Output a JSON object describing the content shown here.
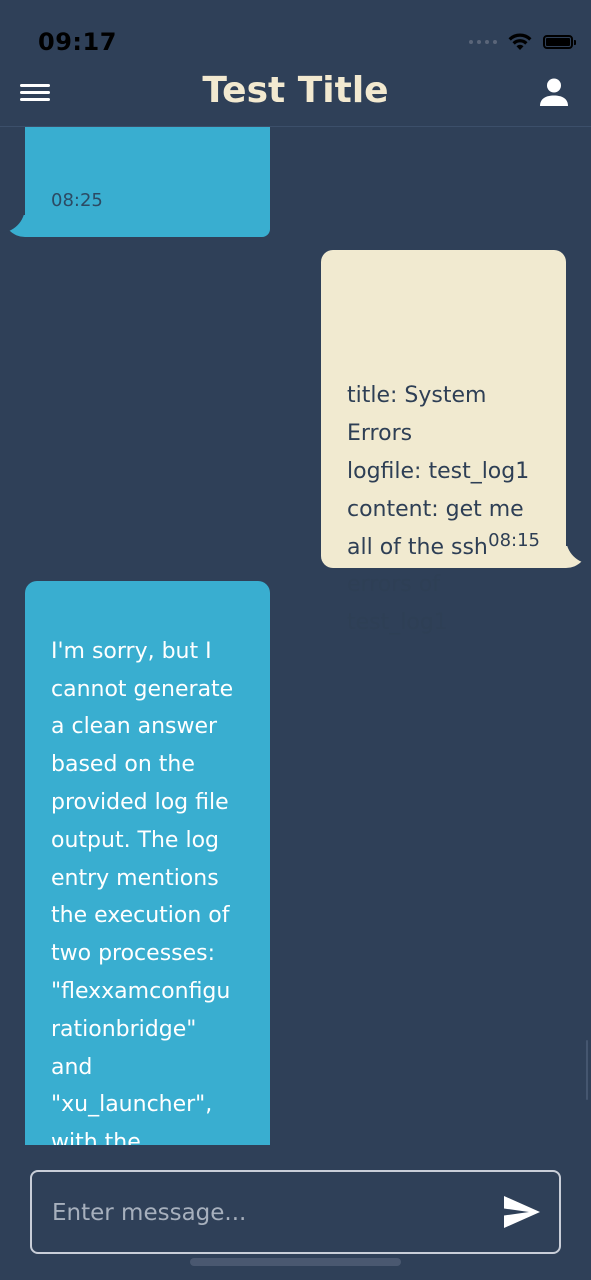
{
  "status_bar": {
    "time": "09:17"
  },
  "header": {
    "title": "Test Title"
  },
  "messages": [
    {
      "sender": "bot",
      "text": "",
      "time": "08:25"
    },
    {
      "sender": "user",
      "text": "title: System\nErrors\nlogfile: test_log1\ncontent: get me\nall of the ssh\nerrors of\ntest_log1",
      "time": "08:15"
    },
    {
      "sender": "bot",
      "text": "I'm sorry, but I\ncannot generate\na clean answer\nbased on the\nprovided log file\noutput. The log\nentry mentions\nthe execution of\ntwo processes:\n\"flexxamconfigu\nrationbridge\"\nand\n\"xu_launcher\",\nwith the\n\"flexxamconfigu"
    }
  ],
  "composer": {
    "placeholder": "Enter message..."
  },
  "colors": {
    "background": "#2f4058",
    "bot_bubble": "#39aed0",
    "user_bubble": "#f1ead0",
    "title": "#f2e9d0"
  },
  "icons": {
    "menu": "menu-icon",
    "profile": "person-icon",
    "send": "send-icon",
    "wifi": "wifi-icon",
    "battery": "battery-icon"
  }
}
